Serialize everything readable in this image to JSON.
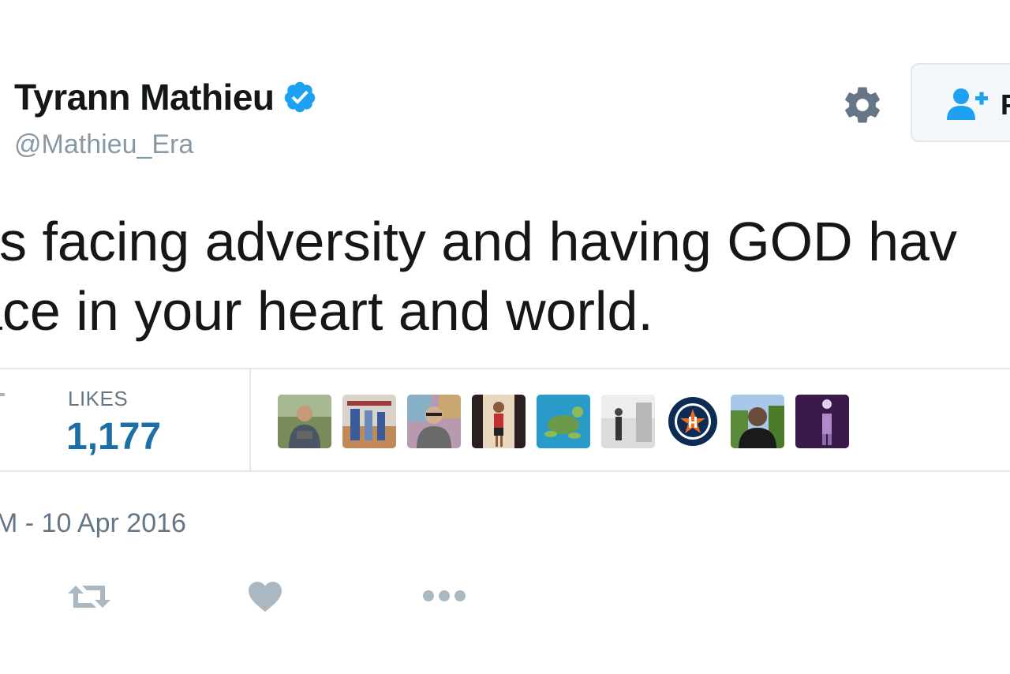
{
  "user": {
    "display_name": "Tyrann Mathieu",
    "handle": "@Mathieu_Era"
  },
  "header": {
    "follow_label": "F"
  },
  "tweet": {
    "line1": " is facing adversity and having GOD hav",
    "line2": "ace in your heart and world."
  },
  "stats": {
    "likes_label": "LIKES",
    "likes_count": "1,177"
  },
  "timestamp": "M - 10 Apr 2016",
  "likers": [
    {
      "name": "liker-avatar-1"
    },
    {
      "name": "liker-avatar-2"
    },
    {
      "name": "liker-avatar-3"
    },
    {
      "name": "liker-avatar-4"
    },
    {
      "name": "liker-avatar-5"
    },
    {
      "name": "liker-avatar-6"
    },
    {
      "name": "liker-avatar-7-houston-astros"
    },
    {
      "name": "liker-avatar-8"
    },
    {
      "name": "liker-avatar-9"
    }
  ],
  "colors": {
    "verified": "#1da1f2",
    "likes_count": "#1b6fa6",
    "icon_gray": "#657786",
    "action_gray": "#aab8c2",
    "follow_icon": "#1da1f2"
  },
  "icons": {
    "verified": "verified-badge-icon",
    "settings": "gear-icon",
    "follow": "add-user-icon",
    "retweet": "retweet-icon",
    "like": "heart-icon",
    "more": "more-icon"
  }
}
